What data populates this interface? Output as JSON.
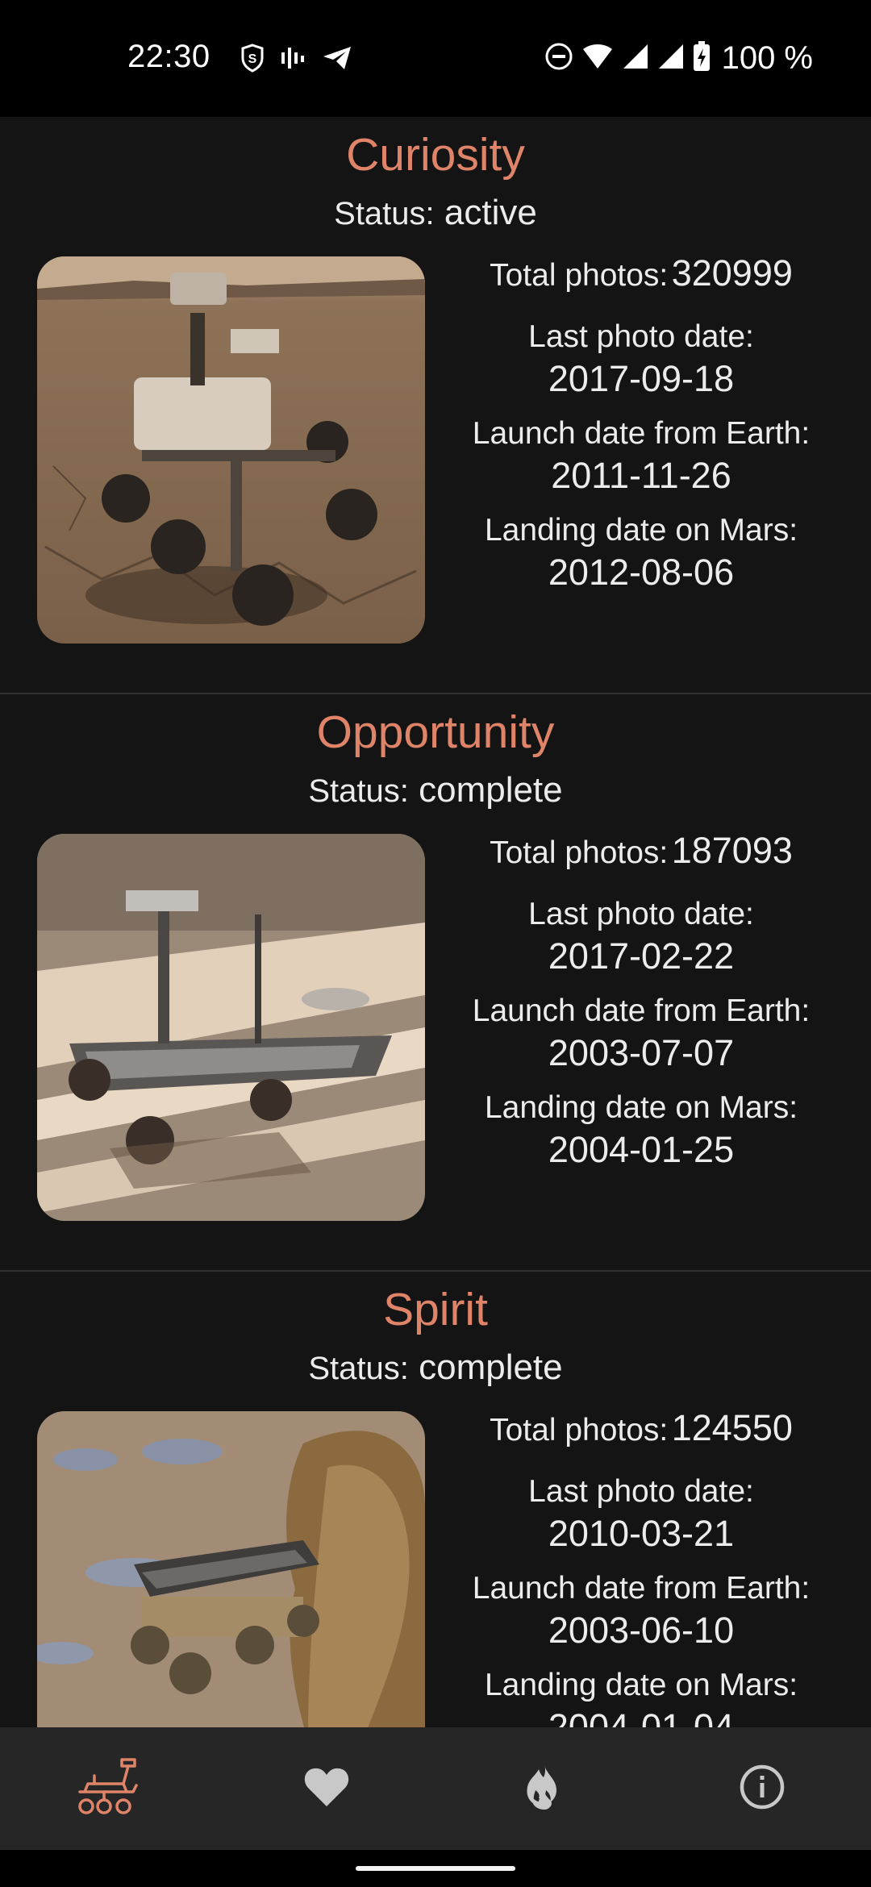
{
  "status_bar": {
    "time": "22:30",
    "battery": "100 %",
    "icons": [
      "shield-s-icon",
      "sound-bars-icon",
      "telegram-icon",
      "dnd-icon",
      "wifi-icon",
      "signal-icon",
      "signal-icon",
      "battery-charging-icon"
    ]
  },
  "rovers": [
    {
      "name": "Curiosity",
      "status_label": "Status:",
      "status": "active",
      "total_photos_label": "Total photos:",
      "total_photos": "320999",
      "last_photo_label": "Last photo date:",
      "last_photo": "2017-09-18",
      "launch_label": "Launch date from Earth:",
      "launch": "2011-11-26",
      "landing_label": "Landing date on Mars:",
      "landing": "2012-08-06"
    },
    {
      "name": "Opportunity",
      "status_label": "Status:",
      "status": "complete",
      "total_photos_label": "Total photos:",
      "total_photos": "187093",
      "last_photo_label": "Last photo date:",
      "last_photo": "2017-02-22",
      "launch_label": "Launch date from Earth:",
      "launch": "2003-07-07",
      "landing_label": "Landing date on Mars:",
      "landing": "2004-01-25"
    },
    {
      "name": "Spirit",
      "status_label": "Status:",
      "status": "complete",
      "total_photos_label": "Total photos:",
      "total_photos": "124550",
      "last_photo_label": "Last photo date:",
      "last_photo": "2010-03-21",
      "launch_label": "Launch date from Earth:",
      "launch": "2003-06-10",
      "landing_label": "Landing date on Mars:",
      "landing": "2004-01-04"
    }
  ],
  "bottom_nav": [
    {
      "icon": "rover-icon",
      "active": true
    },
    {
      "icon": "heart-icon",
      "active": false
    },
    {
      "icon": "fire-icon",
      "active": false
    },
    {
      "icon": "info-icon",
      "active": false
    }
  ],
  "colors": {
    "accent": "#df8468",
    "background": "#141414",
    "nav_background": "#262626",
    "divider": "#303030"
  }
}
